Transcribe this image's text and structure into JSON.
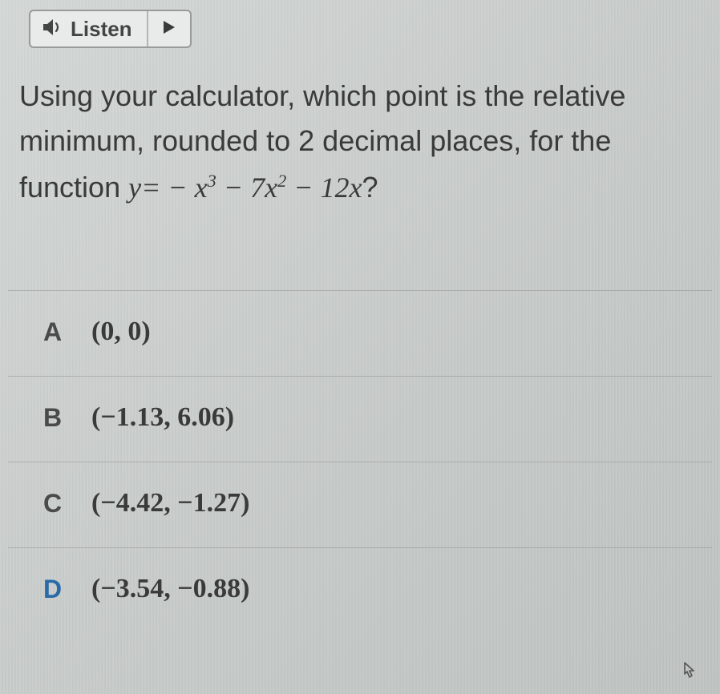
{
  "listen": {
    "label": "Listen"
  },
  "question": {
    "line1": "Using your calculator, which point is the relative",
    "line2": "minimum, rounded to 2 decimal places, for the",
    "line3_prefix": "function ",
    "equation_display": "y = − x³ − 7x² − 12x",
    "line3_suffix": "?"
  },
  "options": [
    {
      "letter": "A",
      "text": "(0, 0)"
    },
    {
      "letter": "B",
      "text": "(−1.13, 6.06)"
    },
    {
      "letter": "C",
      "text": "(−4.42, −1.27)"
    },
    {
      "letter": "D",
      "text": "(−3.54, −0.88)"
    }
  ]
}
